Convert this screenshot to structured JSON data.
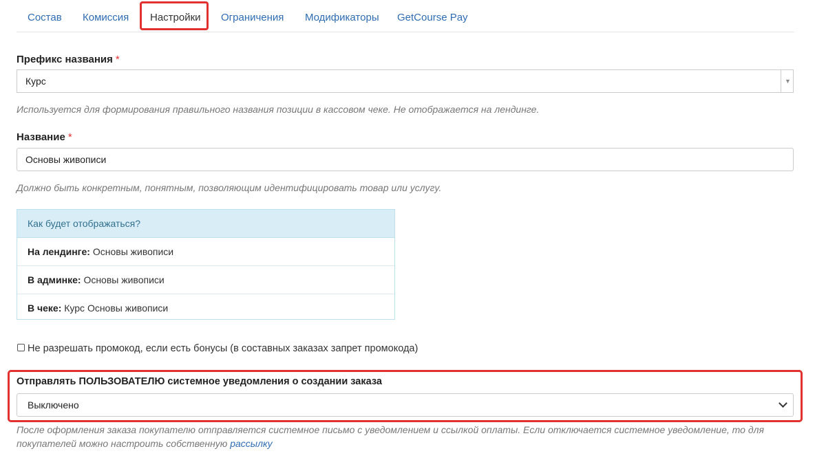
{
  "tabs": [
    {
      "label": "Состав"
    },
    {
      "label": "Комиссия"
    },
    {
      "label": "Настройки"
    },
    {
      "label": "Ограничения"
    },
    {
      "label": "Модификаторы"
    },
    {
      "label": "GetCourse Pay"
    }
  ],
  "active_tab": "Настройки",
  "prefix": {
    "label": "Префикс названия",
    "required_mark": "*",
    "value": "Курс",
    "hint": "Используется для формирования правильного названия позиции в кассовом чеке. Не отображается на лендинге."
  },
  "name": {
    "label": "Название",
    "required_mark": "*",
    "value": "Основы живописи",
    "hint": "Должно быть конкретным, понятным, позволяющим идентифицировать товар или услугу."
  },
  "preview": {
    "title": "Как будет отображаться?",
    "rows": [
      {
        "key": "На лендинге:",
        "value": "Основы живописи"
      },
      {
        "key": "В админке:",
        "value": "Основы живописи"
      },
      {
        "key": "В чеке:",
        "value": "Курс Основы живописи"
      }
    ]
  },
  "promo_checkbox": {
    "label": "Не разрешать промокод, если есть бонусы (в составных заказах запрет промокода)",
    "checked": false
  },
  "notification": {
    "label": "Отправлять ПОЛЬЗОВАТЕЛЮ системное уведомления о создании заказа",
    "value": "Выключено",
    "hint_text": "После оформления заказа покупателю отправляется системное письмо с уведомлением и ссылкой оплаты. Если отключается системное уведомление, то для покупателей можно настроить собственную",
    "hint_link": "рассылку"
  },
  "colors": {
    "link": "#2f6db3",
    "highlight": "#e0302f",
    "required": "#e0302f",
    "info_bg": "#d9edf7"
  }
}
